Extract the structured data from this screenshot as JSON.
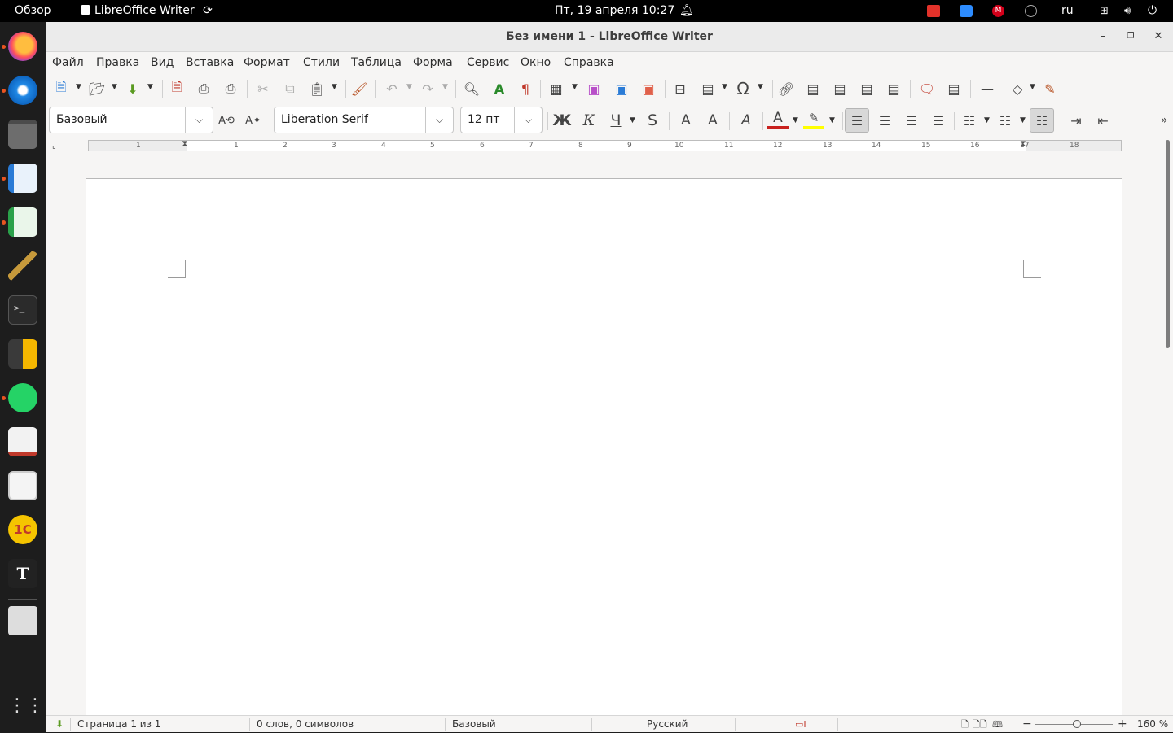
{
  "topbar": {
    "activities": "Обзор",
    "app_name": "LibreOffice Writer",
    "clock": "Пт, 19 апреля  10:27",
    "keyboard_layout": "ru"
  },
  "window": {
    "title": "Без имени 1 - LibreOffice Writer"
  },
  "menubar": {
    "items": [
      "Файл",
      "Правка",
      "Вид",
      "Вставка",
      "Формат",
      "Стили",
      "Таблица",
      "Форма",
      "Сервис",
      "Окно",
      "Справка"
    ]
  },
  "formatting": {
    "paragraph_style": "Базовый",
    "font_name": "Liberation Serif",
    "font_size": "12 пт",
    "bold_label": "Ж",
    "italic_label": "К",
    "underline_label": "Ч",
    "strike_label": "S",
    "superscript_label": "A",
    "subscript_label": "A",
    "clear_format_label": "A",
    "font_color_label": "A"
  },
  "ruler": {
    "numbers": [
      "1",
      "1",
      "2",
      "3",
      "4",
      "5",
      "6",
      "7",
      "8",
      "9",
      "10",
      "11",
      "12",
      "13",
      "14",
      "15",
      "16",
      "17",
      "18"
    ]
  },
  "statusbar": {
    "page": "Страница 1 из 1",
    "words": "0 слов, 0 символов",
    "style": "Базовый",
    "language": "Русский",
    "zoom": "160 %"
  },
  "colors": {
    "accent": "#e95420",
    "font_color": "#c9211e",
    "highlight": "#ffff00"
  }
}
